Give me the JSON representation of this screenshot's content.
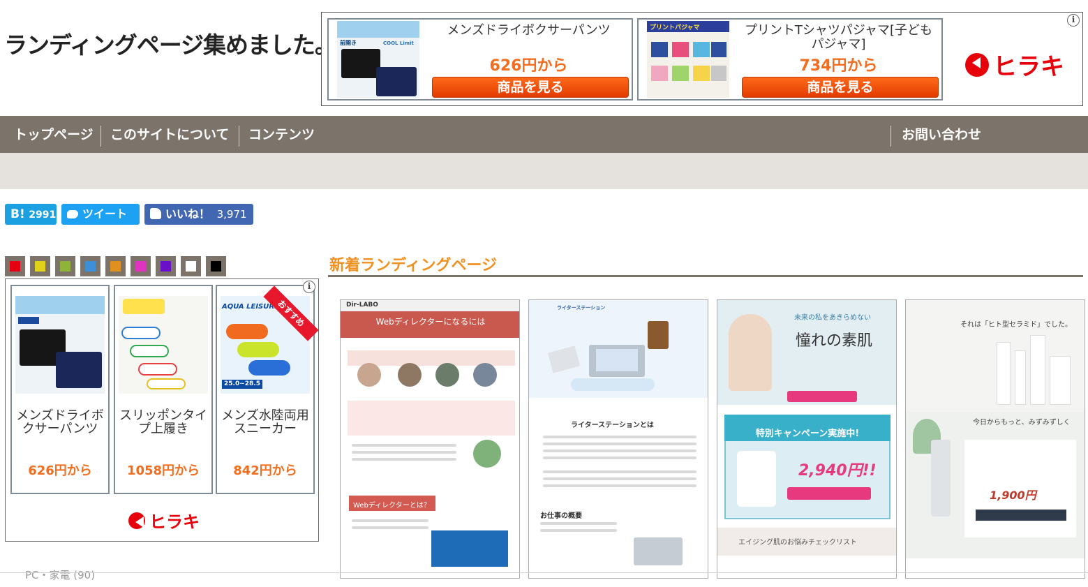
{
  "site": {
    "title": "ランディングページ集めました。"
  },
  "top_ad": {
    "products": [
      {
        "name": "メンズドライボクサーパンツ",
        "price": "626円から",
        "button": "商品を見る",
        "thumb_tag": "前開き",
        "thumb_brand": "COOL Limit"
      },
      {
        "name": "プリントTシャツパジャマ[子どもパジャマ]",
        "price": "734円から",
        "button": "商品を見る",
        "thumb_tag": "プリントパジャマ"
      }
    ],
    "brand": "ヒラキ"
  },
  "nav": {
    "items": [
      "トップページ",
      "このサイトについて",
      "コンテンツ"
    ],
    "contact": "お問い合わせ"
  },
  "social": {
    "hatena_label": "B!",
    "hatena_count": "2991",
    "tweet_label": "ツイート",
    "like_label": "いいね！",
    "like_count": "3,971"
  },
  "color_filter": {
    "colors": [
      "#e60012",
      "#e0d21b",
      "#8fb33a",
      "#3d8fd8",
      "#e0901f",
      "#e033c0",
      "#6a11c7",
      "#ffffff",
      "#000000"
    ]
  },
  "side_ad": {
    "products": [
      {
        "name": "メンズドライボクサーパンツ",
        "price": "626円から"
      },
      {
        "name": "スリッポンタイプ上履き",
        "price": "1058円から"
      },
      {
        "name": "メンズ水陸両用スニーカー",
        "price": "842円から",
        "badge": "おすすめ",
        "thumb_title": "AQUA LEISURE",
        "thumb_size": "25.0~28.5"
      }
    ],
    "brand": "ヒラキ"
  },
  "main": {
    "section_title": "新着ランディングページ",
    "lps": [
      {
        "brand": "Dir-LABO",
        "hero": "Webディレクターになるには",
        "section": "Webディレクターとは？"
      },
      {
        "brand": "ライターステーション",
        "hero": "ライターステーションとは",
        "section": "お仕事の概要"
      },
      {
        "hero_sub": "未来の私をあきらめない",
        "hero": "憧れの素肌",
        "campaign": "特別キャンペーン実施中!",
        "price": "2,940円!!",
        "section": "エイジング肌のお悩みチェックリスト"
      },
      {
        "hero": "それは「ヒト型セラミド」でした。",
        "copy": "今日からもっと、みずみずしく",
        "price": "1,900円"
      }
    ]
  },
  "footer_hint": {
    "text": "PC・家電 (90)"
  }
}
